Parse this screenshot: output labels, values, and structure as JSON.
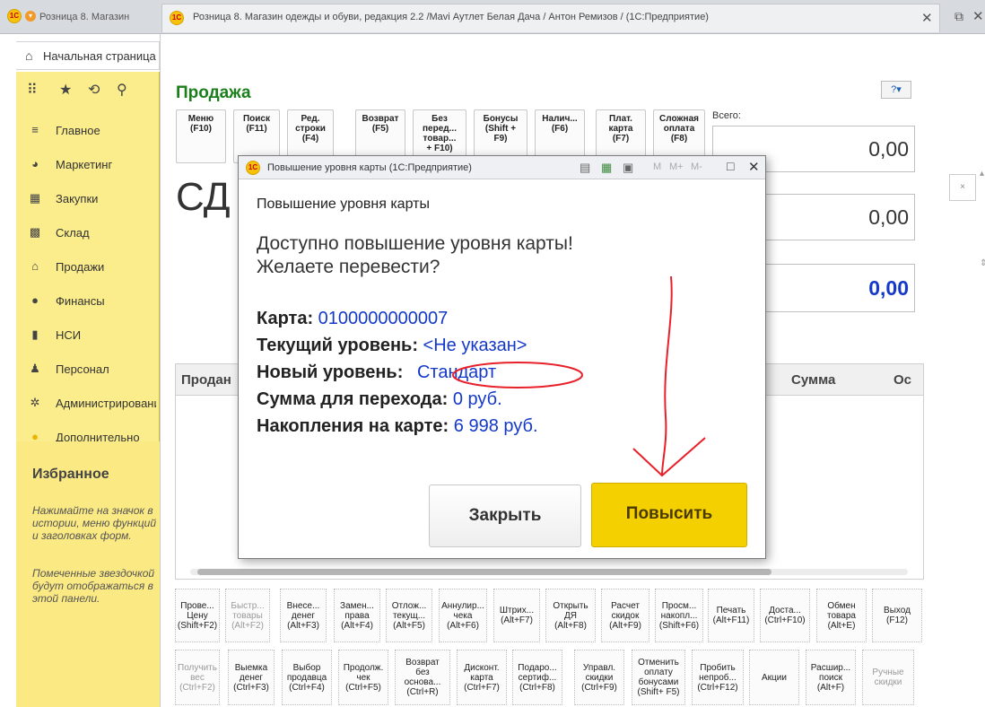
{
  "window": {
    "tab_inactive": "Розница 8. Магазин",
    "tab_active": "Розница 8. Магазин одежды и обуви, редакция 2.2 /Mavi Аутлет Белая Дача / Антон Ремизов /  (1С:Предприятие)",
    "home_tab": "Начальная страница"
  },
  "sidebar": {
    "items": [
      {
        "label": "Главное",
        "icon": "menu-lines-icon"
      },
      {
        "label": "Маркетинг",
        "icon": "pie-chart-icon"
      },
      {
        "label": "Закупки",
        "icon": "purchases-icon"
      },
      {
        "label": "Склад",
        "icon": "warehouse-icon"
      },
      {
        "label": "Продажи",
        "icon": "cart-icon"
      },
      {
        "label": "Финансы",
        "icon": "coin-icon"
      },
      {
        "label": "НСИ",
        "icon": "book-icon"
      },
      {
        "label": "Персонал",
        "icon": "person-icon"
      },
      {
        "label": "Администрирование",
        "icon": "gear-icon"
      },
      {
        "label": "Дополнительно",
        "icon": "bulb-icon"
      }
    ],
    "favorites_title": "Избранное",
    "favorites_hint1": "Нажимайте на значок в истории, меню функций и заголовках форм.",
    "favorites_hint2": "Помеченные звездочкой будут отображаться в этой панели."
  },
  "main": {
    "title": "Продажа",
    "total_label": "Всего:",
    "sum1": "0,00",
    "sum2": "0,00",
    "sum3": "0,00",
    "big_text": "СД",
    "table_col1": "Продан",
    "table_col_sum": "Сумма",
    "table_col_last": "Ос",
    "top_buttons": [
      "Меню\n(F10)",
      "Поиск\n(F11)",
      "Ред.\nстроки\n(F4)",
      "Возврат\n(F5)",
      "Без\nперед...\nтовар...\n+ F10)",
      "Бонусы\n(Shift +\nF9)",
      "Налич...\n(F6)",
      "Плат.\nкарта\n(F7)",
      "Сложная\nоплата\n(F8)"
    ],
    "bottom_row1": [
      "Прове...\nЦену\n(Shift+F2)",
      "Быстр...\nтовары\n(Alt+F2)",
      "Внесе...\nденег\n(Alt+F3)",
      "Замен...\nправа\n(Alt+F4)",
      "Отлож...\nтекущ...\n(Alt+F5)",
      "Аннулир...\nчека\n(Alt+F6)",
      "Штрих...\n(Alt+F7)",
      "Открыть\nДЯ\n(Alt+F8)",
      "Расчет\nскидок\n(Alt+F9)",
      "Просм...\nнакопл...\n(Shift+F6)",
      "Печать\n(Alt+F11)",
      "Доста...\n(Ctrl+F10)",
      "Обмен\nтовара\n(Alt+E)",
      "Выход\n(F12)"
    ],
    "bottom_row2": [
      "Получить\nвес\n(Ctrl+F2)",
      "Выемка\nденег\n(Ctrl+F3)",
      "Выбор\nпродавца\n(Ctrl+F4)",
      "Продолж.\nчек\n(Ctrl+F5)",
      "Возврат\nбез\nоснова...\n(Ctrl+R)",
      "Дисконт.\nкарта\n(Ctrl+F7)",
      "Подаро...\nсертиф...\n(Ctrl+F8)",
      "Управл.\nскидки\n(Ctrl+F9)",
      "Отменить\nоплату\nбонусами\n(Shift+ F5)",
      "Пробить\nнепроб...\n(Ctrl+F12)",
      "Акции",
      "Расшир...\nпоиск\n(Alt+F)",
      "Ручные\nскидки"
    ]
  },
  "dialog": {
    "window_title": "Повышение уровня карты  (1С:Предприятие)",
    "header": "Повышение уровня карты",
    "message_line1": "Доступно повышение уровня карты!",
    "message_line2": "Желаете перевести?",
    "card_label": "Карта:",
    "card_value": "0100000000007",
    "current_label": "Текущий уровень:",
    "current_value": "<Не указан>",
    "new_label": "Новый уровень:",
    "new_value": "Стандарт",
    "transition_label": "Сумма для перехода:",
    "transition_value": "0 руб.",
    "savings_label": "Накопления на карте:",
    "savings_value": "6 998 руб.",
    "close_button": "Закрыть",
    "upgrade_button": "Повысить",
    "toolbar_m": "M",
    "toolbar_mplus": "M+",
    "toolbar_mminus": "M-"
  },
  "colors": {
    "accent_yellow": "#f5d000",
    "nav_yellow": "#fbec8c",
    "link_blue": "#1439c8",
    "title_green": "#1a7f1a",
    "annotation_red": "#e8202a"
  }
}
